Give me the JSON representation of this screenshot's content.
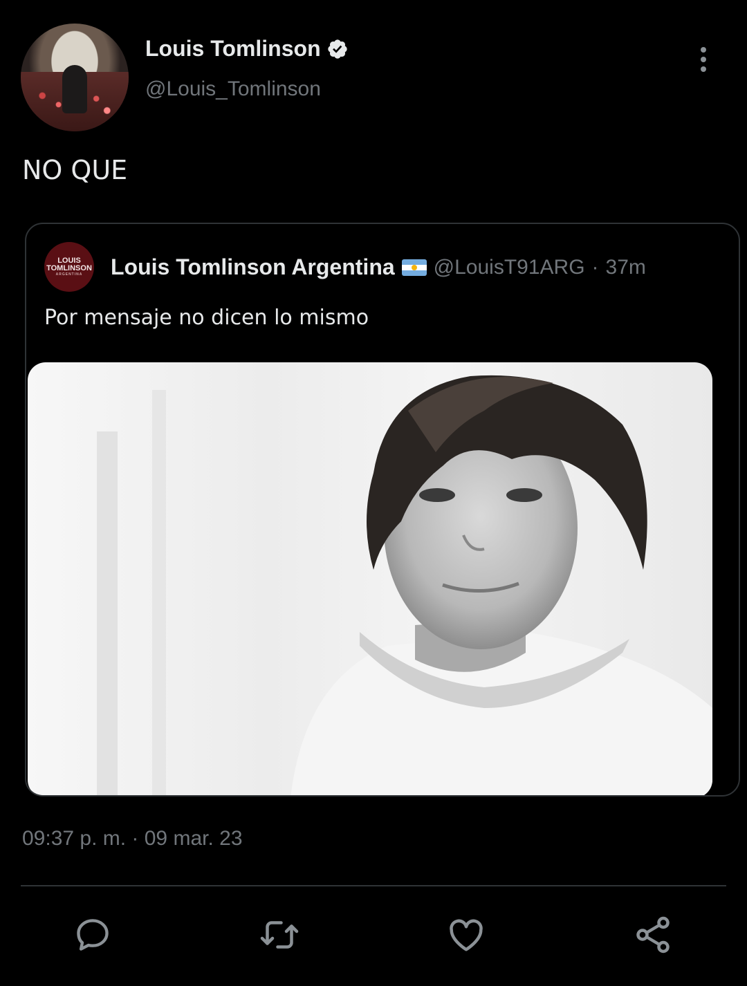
{
  "author": {
    "name": "Louis Tomlinson",
    "handle": "@Louis_Tomlinson",
    "verified_icon": "verified-badge-icon",
    "avatar": "concert-stage-avatar"
  },
  "tweet": {
    "text": "NO QUE",
    "timestamp": "09:37 p. m. · 09 mar. 23"
  },
  "quoted_tweet": {
    "name": "Louis Tomlinson Argentina",
    "flag": "argentina-flag-icon",
    "handle": "@LouisT91ARG",
    "time": "37m",
    "separator": "·",
    "text": "Por mensaje no dicen lo mismo",
    "avatar_logo": {
      "line1": "LOUIS",
      "line2": "TOMLINSON",
      "line3": "ARGENTINA"
    },
    "image": "black-and-white-portrait-photo"
  },
  "actions": [
    {
      "name": "reply",
      "icon": "reply-icon"
    },
    {
      "name": "retweet",
      "icon": "retweet-icon"
    },
    {
      "name": "like",
      "icon": "heart-icon"
    },
    {
      "name": "share",
      "icon": "share-icon"
    }
  ],
  "colors": {
    "background": "#000000",
    "text_primary": "#e7e9ea",
    "text_secondary": "#71767b",
    "border": "#2f3336"
  }
}
